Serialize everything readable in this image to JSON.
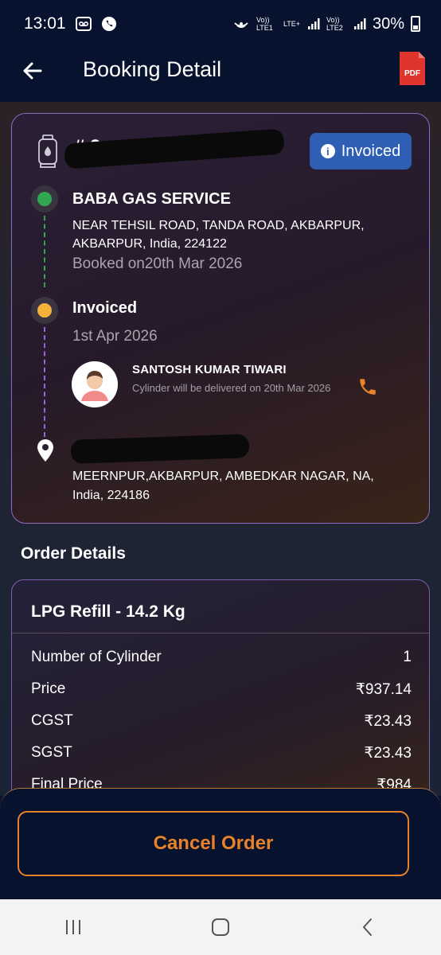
{
  "status_bar": {
    "time": "13:01",
    "network_labels": [
      "Vo)) LTE1",
      "LTE+",
      "Vo)) LTE2"
    ],
    "battery": "30%"
  },
  "header": {
    "title": "Booking Detail",
    "pdf_label": "PDF"
  },
  "booking": {
    "order_prefix": "# 2",
    "status_badge": "Invoiced",
    "distributor": {
      "name": "BABA GAS SERVICE",
      "address": "NEAR TEHSIL ROAD, TANDA ROAD, AKBARPUR, AKBARPUR, India, 224122",
      "booked_on": "Booked on20th Mar 2026",
      "dot_color": "#2fa84f"
    },
    "invoiced": {
      "label": "Invoiced",
      "date": "1st Apr 2026",
      "dot_color": "#f5b13a"
    },
    "agent": {
      "name": "SANTOSH KUMAR TIWARI",
      "note": "Cylinder will be delivered on 20th Mar 2026"
    },
    "delivery": {
      "address": "MEERNPUR,AKBARPUR, AMBEDKAR NAGAR, NA, India, 224186"
    }
  },
  "order_details": {
    "section_title": "Order Details",
    "product": "LPG Refill - 14.2 Kg",
    "rows": [
      {
        "label": "Number of Cylinder",
        "value": "1"
      },
      {
        "label": "Price",
        "value": "₹937.14"
      },
      {
        "label": "CGST",
        "value": "₹23.43"
      },
      {
        "label": "SGST",
        "value": "₹23.43"
      },
      {
        "label": "Final Price",
        "value": "₹984"
      }
    ]
  },
  "actions": {
    "cancel_label": "Cancel Order"
  },
  "colors": {
    "accent_orange": "#e8822a",
    "badge_blue": "#2e5fb5",
    "app_bar": "#07122e"
  }
}
